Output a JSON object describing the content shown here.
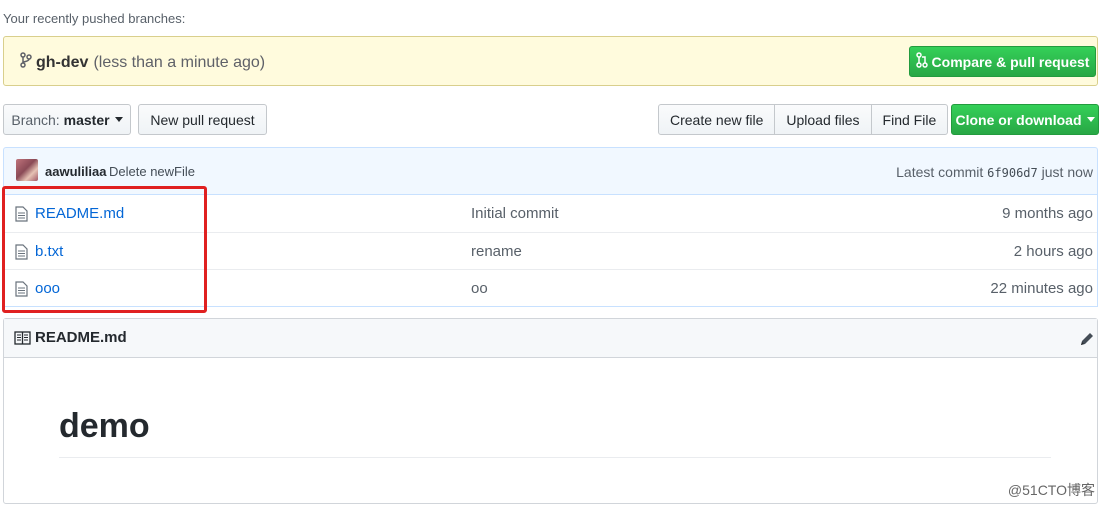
{
  "recent": {
    "label": "Your recently pushed branches:",
    "branch_name": "gh-dev",
    "time": "(less than a minute ago)",
    "compare_label": "Compare & pull request"
  },
  "toolbar": {
    "branch_prefix": "Branch:",
    "branch_value": "master",
    "new_pr": "New pull request",
    "create_file": "Create new file",
    "upload_files": "Upload files",
    "find_file": "Find File",
    "clone": "Clone or download"
  },
  "commit": {
    "author": "aawuliliaa",
    "message": "Delete newFile",
    "latest_prefix": "Latest commit",
    "sha": "6f906d7",
    "when": "just now"
  },
  "files": [
    {
      "name": "README.md",
      "message": "Initial commit",
      "age": "9 months ago"
    },
    {
      "name": "b.txt",
      "message": "rename",
      "age": "2 hours ago"
    },
    {
      "name": "ooo",
      "message": "oo",
      "age": "22 minutes ago"
    }
  ],
  "readme": {
    "title": "README.md",
    "heading": "demo"
  },
  "watermark": "@51CTO博客",
  "colors": {
    "green": "#28a745",
    "link": "#0366d6",
    "banner": "#fffbdd",
    "highlight": "#e02020"
  }
}
